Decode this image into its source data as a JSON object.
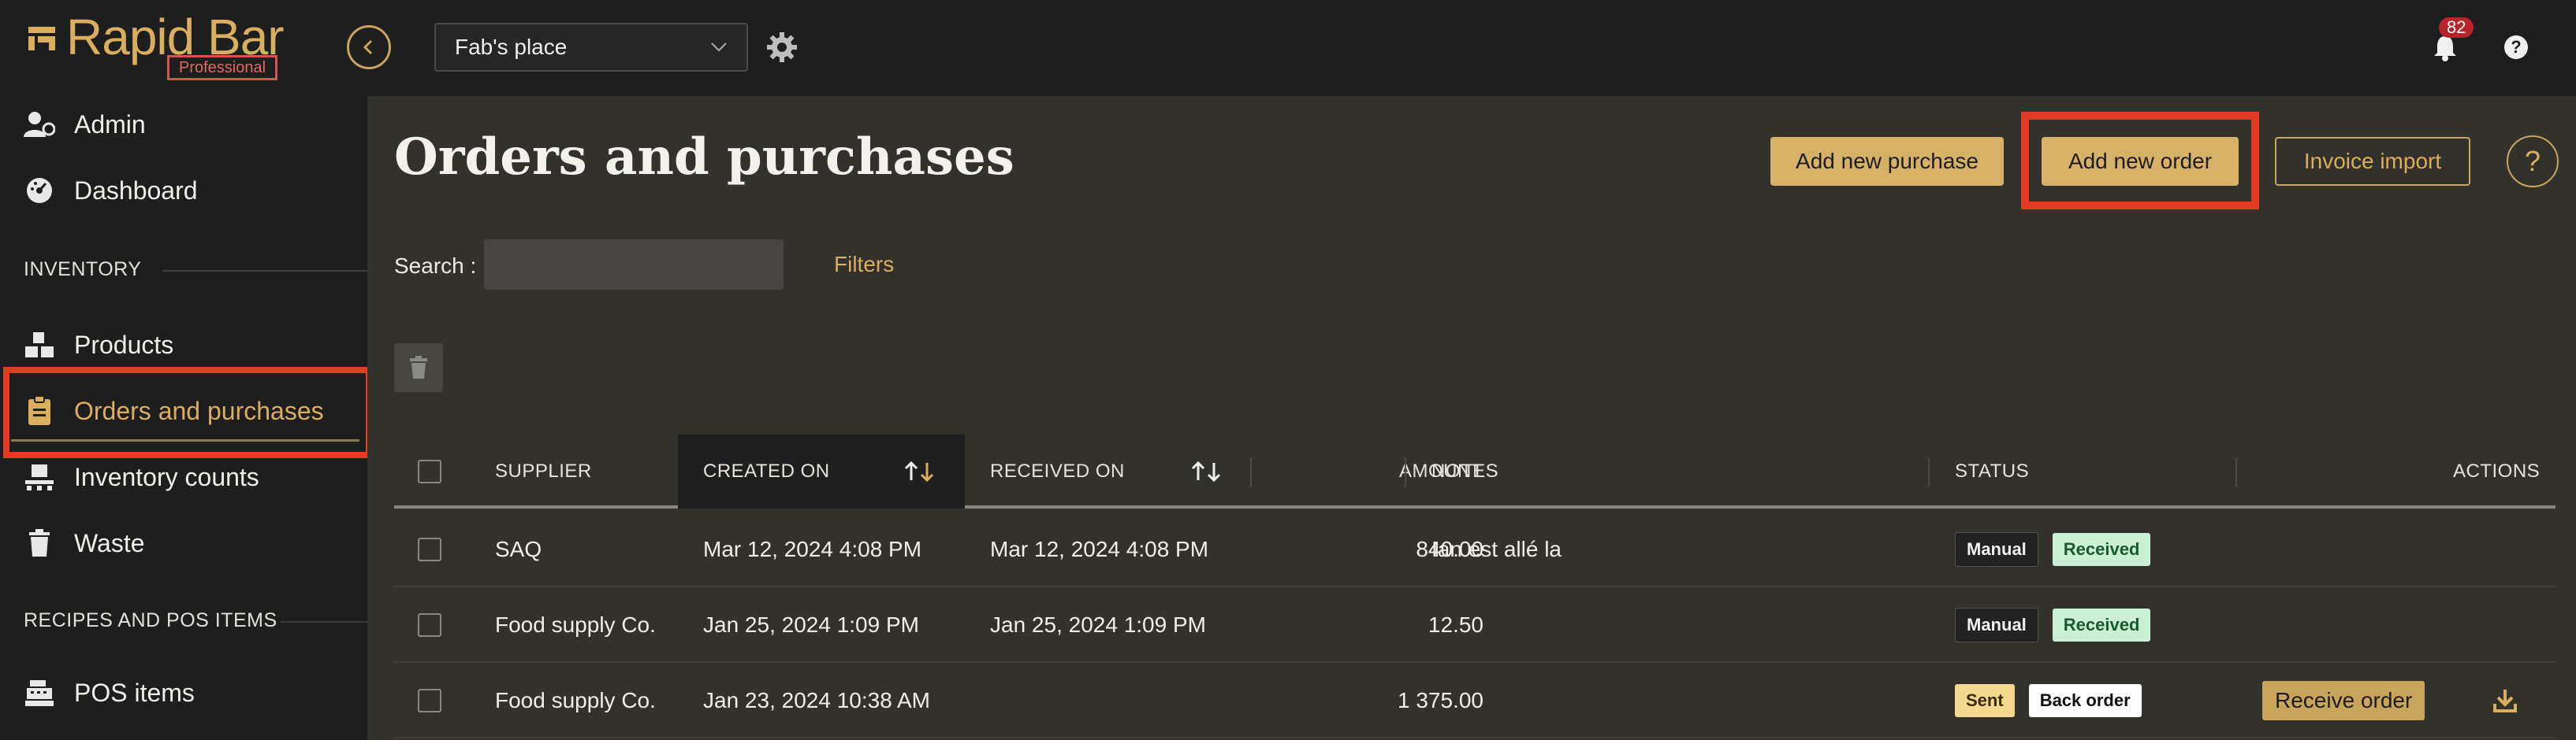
{
  "brand": {
    "name": "Rapid Bar",
    "tier": "Professional",
    "accent": "#d9ae5f"
  },
  "topbar": {
    "location": "Fab's place",
    "notification_count": "82"
  },
  "sidebar": {
    "items_top": [
      {
        "label": "Admin",
        "icon": "user-gear-icon"
      },
      {
        "label": "Dashboard",
        "icon": "gauge-icon"
      }
    ],
    "section_inventory": "INVENTORY",
    "items_inventory": [
      {
        "label": "Products",
        "icon": "boxes-icon"
      },
      {
        "label": "Orders and purchases",
        "icon": "clipboard-icon",
        "active": true
      },
      {
        "label": "Inventory counts",
        "icon": "pallet-icon"
      },
      {
        "label": "Waste",
        "icon": "trash-icon"
      }
    ],
    "section_recipes": "RECIPES AND POS ITEMS",
    "items_recipes": [
      {
        "label": "POS items",
        "icon": "cash-register-icon"
      }
    ]
  },
  "main": {
    "title": "Orders and purchases",
    "buttons": {
      "add_purchase": "Add new purchase",
      "add_order": "Add new order",
      "invoice_import": "Invoice import"
    },
    "help_symbol": "?",
    "search": {
      "label": "Search :",
      "value": "",
      "placeholder": ""
    },
    "filters": "Filters"
  },
  "table": {
    "columns": {
      "supplier": "SUPPLIER",
      "created_on": "CREATED ON",
      "received_on": "RECEIVED ON",
      "amount": "AMOUNT",
      "notes": "NOTES",
      "status": "STATUS",
      "actions": "ACTIONS"
    },
    "rows": [
      {
        "supplier": "SAQ",
        "created_on": "Mar 12, 2024 4:08 PM",
        "received_on": "Mar 12, 2024 4:08 PM",
        "amount": "840.00",
        "notes": "Ian est allé la",
        "status": [
          "Manual",
          "Received"
        ],
        "action": ""
      },
      {
        "supplier": "Food supply Co.",
        "created_on": "Jan 25, 2024 1:09 PM",
        "received_on": "Jan 25, 2024 1:09 PM",
        "amount": "12.50",
        "notes": "",
        "status": [
          "Manual",
          "Received"
        ],
        "action": ""
      },
      {
        "supplier": "Food supply Co.",
        "created_on": "Jan 23, 2024 10:38 AM",
        "received_on": "",
        "amount": "1 375.00",
        "notes": "",
        "status": [
          "Sent",
          "Back order"
        ],
        "action": "Receive order"
      }
    ]
  }
}
